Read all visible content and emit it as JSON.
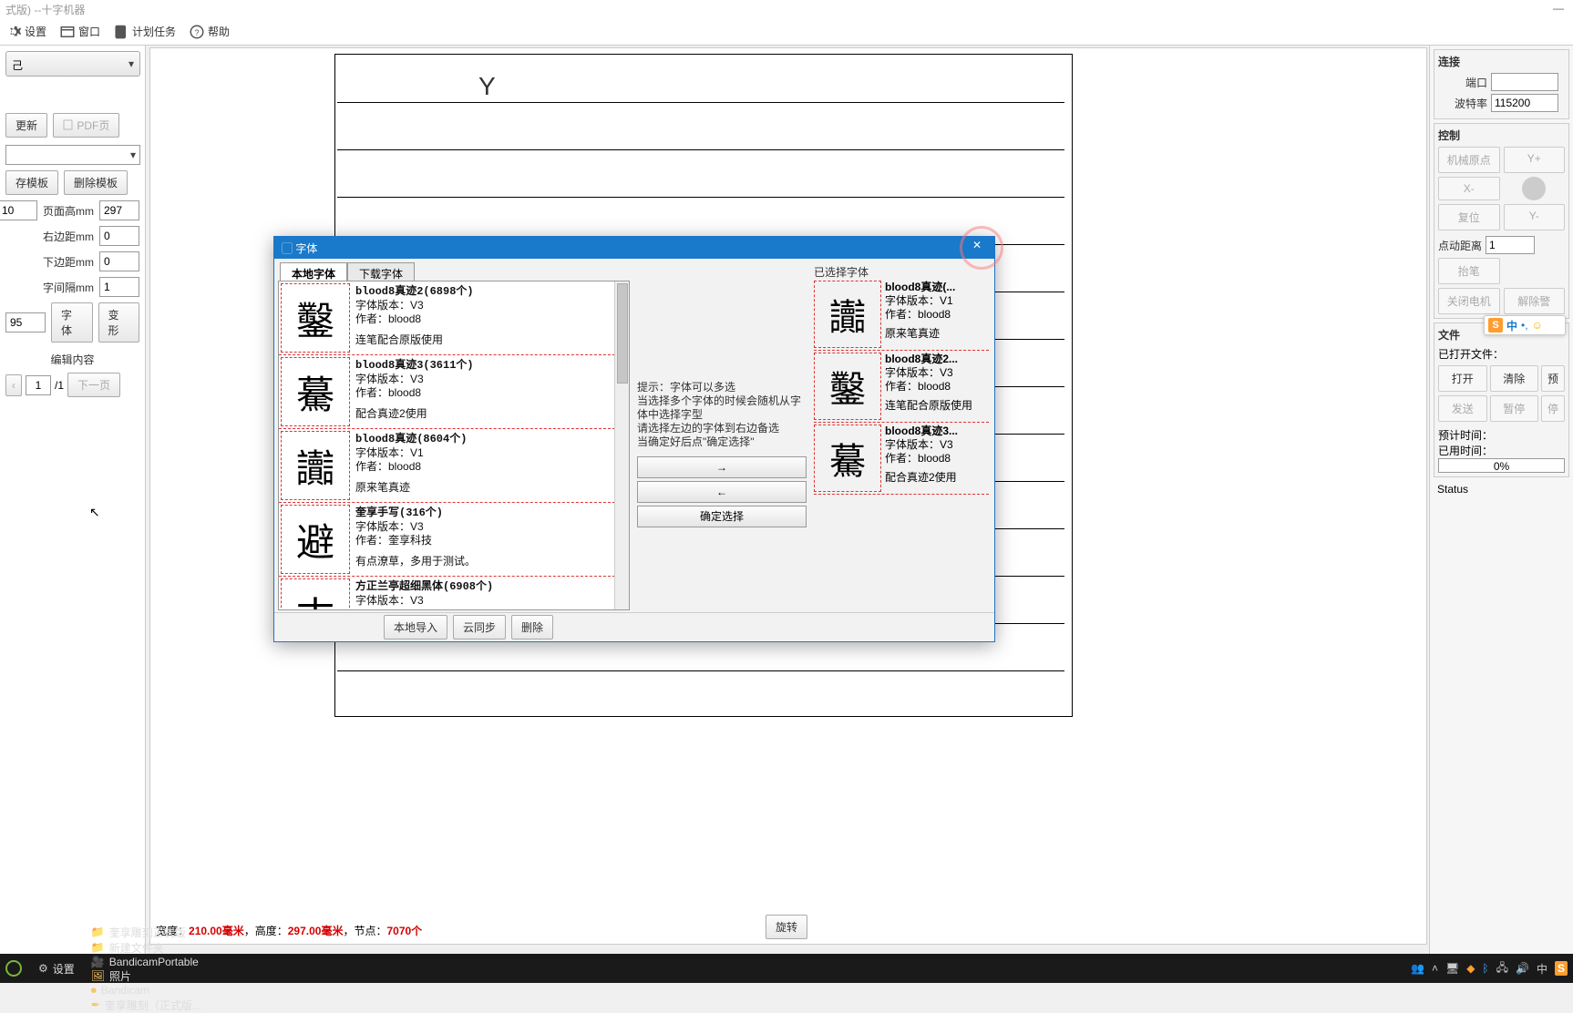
{
  "window": {
    "title": "式版) --十字机器"
  },
  "toolbar": {
    "settings": "设置",
    "window": "窗口",
    "tasks": "计划任务",
    "help": "帮助"
  },
  "left": {
    "combo1_value": "己",
    "update_btn": "更新",
    "pdf_btn": "PDF页",
    "save_tpl": "存模板",
    "del_tpl": "删除模板",
    "page_w_lbl": "页面宽mm",
    "page_w_hidden": "10",
    "page_h_lbl": "页面高mm",
    "page_h": "297",
    "margin_r_lbl": "右边距mm",
    "margin_r": "0",
    "margin_b_lbl": "下边距mm",
    "margin_b": "0",
    "char_gap_lbl": "字间隔mm",
    "char_gap": "1",
    "line_h": "95",
    "font_btn": "字体",
    "transform_btn": "变形",
    "edit_section": "编辑内容",
    "page_num": "1",
    "page_total": "/1",
    "next_page": "下一页"
  },
  "canvas": {
    "status_prefix": "宽度：",
    "width": "210.00毫米",
    "mid": "，高度：",
    "height": "297.00毫米",
    "nodes_lbl": "，节点：",
    "nodes": "7070个"
  },
  "right": {
    "connect": {
      "title": "连接",
      "port": "端口",
      "baud": "波特率",
      "baud_val": "115200"
    },
    "control": {
      "title": "控制",
      "home": "机械原点",
      "yplus": "Y+",
      "xminus": "X-",
      "reset": "复位",
      "yminus": "Y-",
      "jog": "点动距离",
      "jog_val": "1",
      "pen_up": "抬笔",
      "motor_off": "关闭电机",
      "clear": "解除警"
    },
    "file": {
      "title": "文件",
      "opened": "已打开文件：",
      "open": "打开",
      "clear": "清除",
      "preview": "预",
      "send": "发送",
      "pause": "暂停",
      "stop": "停",
      "est": "预计时间：",
      "used": "已用时间：",
      "progress": "0%"
    },
    "status": "Status"
  },
  "rotate_btn": "旋转",
  "modal": {
    "title": "字体",
    "tab_local": "本地字体",
    "tab_download": "下载字体",
    "list": [
      {
        "glyph": "鑿",
        "name": "blood8真迹2(6898个)",
        "ver": "字体版本：V3",
        "author": "作者：blood8",
        "note": "连笔配合原版使用"
      },
      {
        "glyph": "驀",
        "name": "blood8真迹3(3611个)",
        "ver": "字体版本：V3",
        "author": "作者：blood8",
        "note": "配合真迹2使用"
      },
      {
        "glyph": "讟",
        "name": "blood8真迹(8604个)",
        "ver": "字体版本：V1",
        "author": "作者：blood8",
        "note": "原来笔真迹"
      },
      {
        "glyph": "避",
        "name": "奎享手写(316个)",
        "ver": "字体版本：V3",
        "author": "作者：奎享科技",
        "note": "有点潦草，多用于测试。"
      },
      {
        "glyph": "古",
        "name": "方正兰亭超细黑体(6908个)",
        "ver": "字体版本：V3",
        "author": "",
        "note": ""
      }
    ],
    "hint_l1": "提示：字体可以多选",
    "hint_l2": "当选择多个字体的时候会随机从字体中选择字型",
    "hint_l3": "请选择左边的字体到右边备选",
    "hint_l4": "当确定好后点\"确定选择\"",
    "arrow_right": "→",
    "arrow_left": "←",
    "confirm": "确定选择",
    "selected_title": "已选择字体",
    "selected": [
      {
        "glyph": "讟",
        "name": "blood8真迹(...",
        "ver": "字体版本：V1",
        "author": "作者：blood8",
        "note": "原来笔真迹"
      },
      {
        "glyph": "鑿",
        "name": "blood8真迹2...",
        "ver": "字体版本：V3",
        "author": "作者：blood8",
        "note": "连笔配合原版使用"
      },
      {
        "glyph": "驀",
        "name": "blood8真迹3...",
        "ver": "字体版本：V3",
        "author": "作者：blood8",
        "note": "配合真迹2使用"
      }
    ],
    "footer": {
      "import": "本地导入",
      "sync": "云同步",
      "delete": "删除"
    }
  },
  "ime": {
    "s": "S",
    "cn": "中",
    "punct": "•,",
    "smile": "☺"
  },
  "taskbar": {
    "settings": "设置",
    "items": [
      "奎享雕刻正式版",
      "新建文件夹",
      "BandicamPortable",
      "照片",
      "Bandicam",
      "奎享雕刻（正式版..."
    ],
    "tray_cn": "中"
  }
}
